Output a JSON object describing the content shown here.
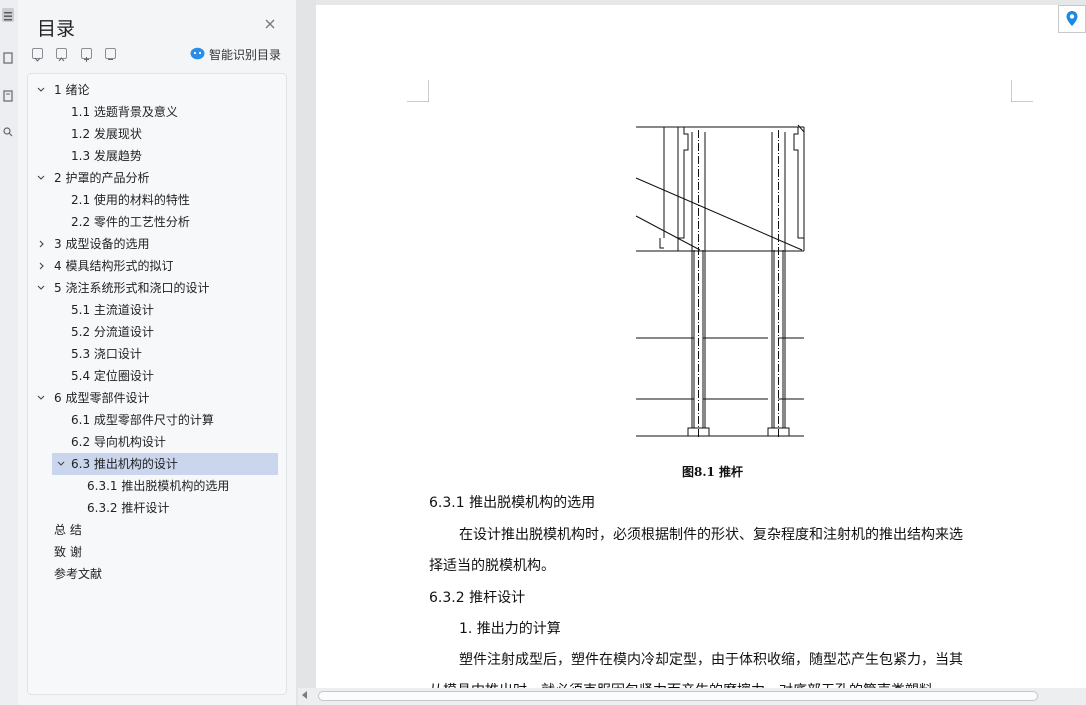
{
  "toc": {
    "title": "目录",
    "smart_label": "智能识别目录",
    "items": [
      {
        "label": "1 绪论",
        "level": 1,
        "expanded": true
      },
      {
        "label": "1.1  选题背景及意义",
        "level": 2
      },
      {
        "label": "1.2  发展现状",
        "level": 2
      },
      {
        "label": "1.3  发展趋势",
        "level": 2
      },
      {
        "label": "2 护罩的产品分析",
        "level": 1,
        "expanded": true
      },
      {
        "label": "2.1 使用的材料的特性",
        "level": 2
      },
      {
        "label": "2.2 零件的工艺性分析",
        "level": 2
      },
      {
        "label": "3 成型设备的选用",
        "level": 1,
        "expanded": false
      },
      {
        "label": "4 模具结构形式的拟订",
        "level": 1,
        "expanded": false
      },
      {
        "label": "5 浇注系统形式和浇口的设计",
        "level": 1,
        "expanded": true
      },
      {
        "label": "5.1 主流道设计",
        "level": 2
      },
      {
        "label": "5.2 分流道设计",
        "level": 2
      },
      {
        "label": "5.3 浇口设计",
        "level": 2
      },
      {
        "label": "5.4 定位圈设计",
        "level": 2
      },
      {
        "label": "6 成型零部件设计",
        "level": 1,
        "expanded": true
      },
      {
        "label": "6.1 成型零部件尺寸的计算",
        "level": 2
      },
      {
        "label": "6.2 导向机构设计",
        "level": 2
      },
      {
        "label": "6.3 推出机构的设计",
        "level": 2,
        "expanded": true,
        "selected": true
      },
      {
        "label": "6.3.1 推出脱模机构的选用",
        "level": 3
      },
      {
        "label": "6.3.2 推杆设计",
        "level": 3
      },
      {
        "label": "总   结",
        "level": 1
      },
      {
        "label": "致   谢",
        "level": 1
      },
      {
        "label": "参考文献",
        "level": 1
      }
    ]
  },
  "document": {
    "figure_caption": "图8.1   推杆",
    "paragraphs": [
      "6.3.1 推出脱模机构的选用",
      "在设计推出脱模机构时，必须根据制件的形状、复杂程度和注射机的推出结构来选",
      "择适当的脱模机构。",
      "6.3.2 推杆设计",
      "1. 推出力的计算",
      "塑件注射成型后，塑件在模内冷却定型，由于体积收缩，随型芯产生包紧力，当其",
      "从模具中推出时，就必须克服因包紧力而产生的摩擦力。对底部无孔的筒壳类塑料"
    ]
  },
  "colors": {
    "accent": "#1e88e5",
    "selected_bg": "#c9d6ee"
  },
  "icons": {
    "close": "close-icon",
    "smart": "robot-icon",
    "location": "location-pin-icon"
  }
}
